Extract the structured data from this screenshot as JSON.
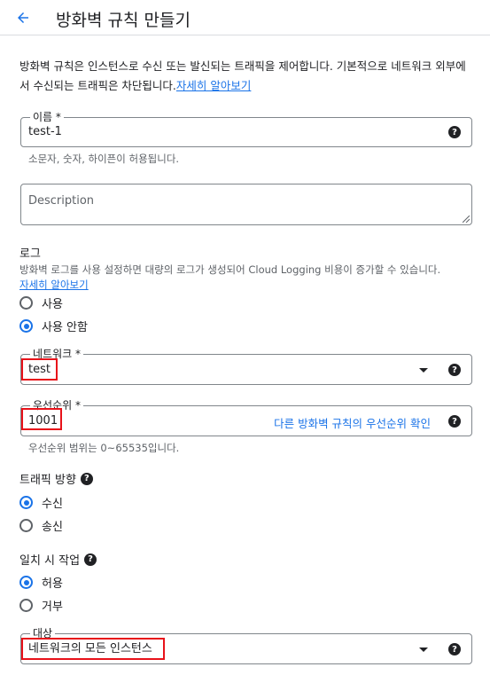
{
  "header": {
    "title": "방화벽 규칙 만들기",
    "back_icon": "arrow-back-icon"
  },
  "intro": {
    "text": "방화벽 규칙은 인스턴스로 수신 또는 발신되는 트래픽을 제어합니다. 기본적으로 네트워크 외부에서 수신되는 트래픽은 차단됩니다.",
    "link": "자세히 알아보기"
  },
  "name_field": {
    "label": "이름 *",
    "value": "test-1",
    "hint": "소문자, 숫자, 하이픈이 허용됩니다."
  },
  "description_field": {
    "placeholder": "Description"
  },
  "logs": {
    "title": "로그",
    "desc": "방화벽 로그를 사용 설정하면 대량의 로그가 생성되어 Cloud Logging 비용이 증가할 수 있습니다.",
    "link": "자세히 알아보기",
    "options": [
      "사용",
      "사용 안함"
    ],
    "selected": "사용 안함"
  },
  "network_field": {
    "label": "네트워크 *",
    "value": "test"
  },
  "priority_field": {
    "label": "우선순위 *",
    "value": "1001",
    "link": "다른 방화벽 규칙의 우선순위 확인",
    "hint": "우선순위 범위는 0~65535입니다."
  },
  "traffic_direction": {
    "title": "트래픽 방향",
    "options": [
      "수신",
      "송신"
    ],
    "selected": "수신"
  },
  "match_action": {
    "title": "일치 시 작업",
    "options": [
      "허용",
      "거부"
    ],
    "selected": "허용"
  },
  "target_field": {
    "label": "대상",
    "value": "네트워크의 모든 인스턴스"
  },
  "colors": {
    "accent": "#1a73e8",
    "highlight": "#e8121a",
    "text": "#202124",
    "muted": "#5f6368"
  }
}
